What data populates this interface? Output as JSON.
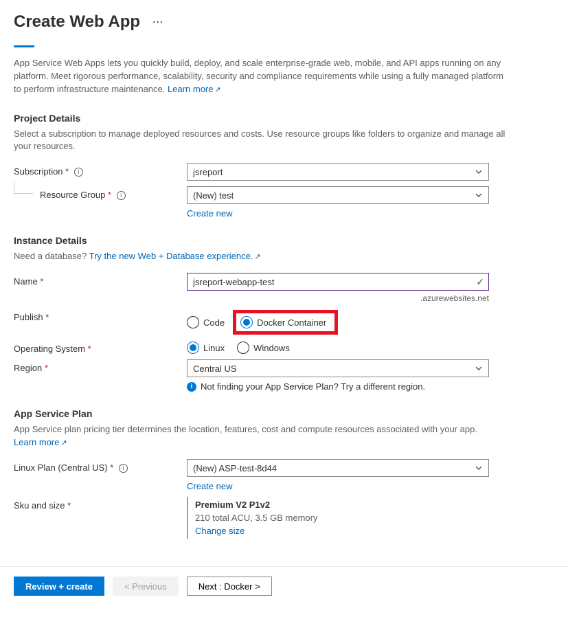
{
  "header": {
    "title": "Create Web App"
  },
  "intro": {
    "text": "App Service Web Apps lets you quickly build, deploy, and scale enterprise-grade web, mobile, and API apps running on any platform. Meet rigorous performance, scalability, security and compliance requirements while using a fully managed platform to perform infrastructure maintenance. ",
    "learn_more": "Learn more"
  },
  "project_details": {
    "title": "Project Details",
    "desc": "Select a subscription to manage deployed resources and costs. Use resource groups like folders to organize and manage all your resources.",
    "subscription_label": "Subscription",
    "subscription_value": "jsreport",
    "resource_group_label": "Resource Group",
    "resource_group_value": "(New) test",
    "create_new": "Create new"
  },
  "instance": {
    "title": "Instance Details",
    "db_text": "Need a database? ",
    "db_link": "Try the new Web + Database experience.",
    "name_label": "Name",
    "name_value": "jsreport-webapp-test",
    "suffix": ".azurewebsites.net",
    "publish_label": "Publish",
    "publish_code": "Code",
    "publish_docker": "Docker Container",
    "os_label": "Operating System",
    "os_linux": "Linux",
    "os_windows": "Windows",
    "region_label": "Region",
    "region_value": "Central US",
    "region_hint": "Not finding your App Service Plan? Try a different region."
  },
  "plan": {
    "title": "App Service Plan",
    "desc_text": "App Service plan pricing tier determines the location, features, cost and compute resources associated with your app. ",
    "learn_more": "Learn more",
    "linux_plan_label": "Linux Plan (Central US)",
    "linux_plan_value": "(New) ASP-test-8d44",
    "create_new": "Create new",
    "sku_label": "Sku and size",
    "sku_title": "Premium V2 P1v2",
    "sku_desc": "210 total ACU, 3.5 GB memory",
    "change_size": "Change size"
  },
  "footer": {
    "review": "Review + create",
    "previous": "< Previous",
    "next": "Next : Docker >"
  }
}
